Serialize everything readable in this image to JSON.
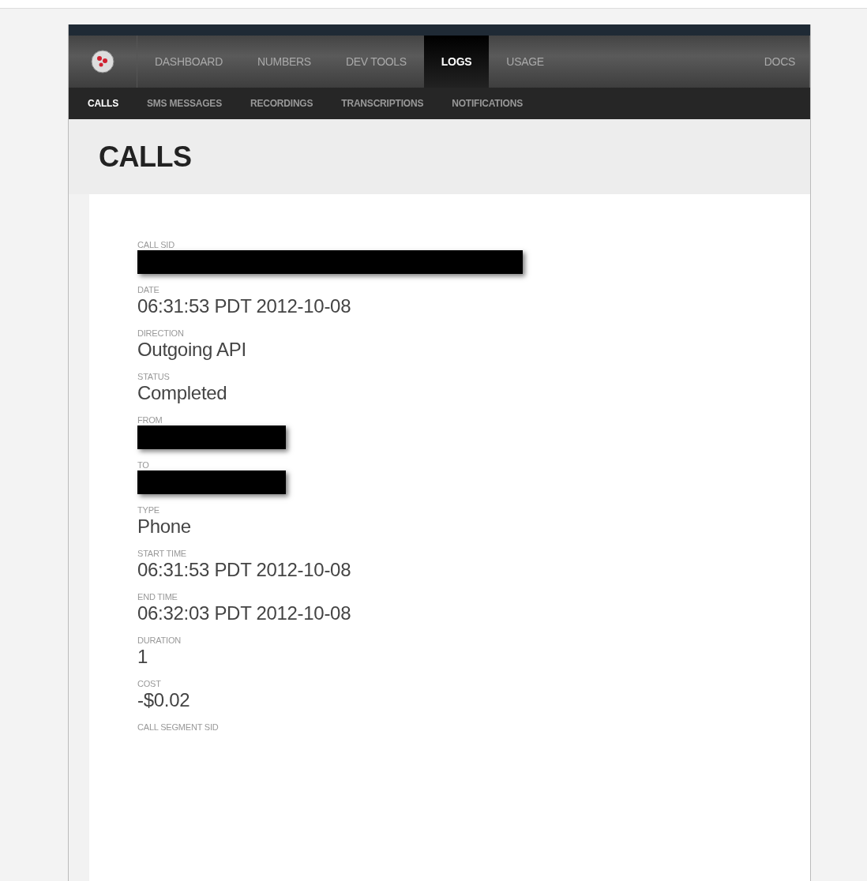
{
  "nav": {
    "items": [
      {
        "label": "DASHBOARD",
        "selected": false
      },
      {
        "label": "NUMBERS",
        "selected": false
      },
      {
        "label": "DEV TOOLS",
        "selected": false
      },
      {
        "label": "LOGS",
        "selected": true
      },
      {
        "label": "USAGE",
        "selected": false
      }
    ],
    "right_items": [
      "DOCS"
    ]
  },
  "subnav": [
    {
      "label": "CALLS",
      "selected": true
    },
    {
      "label": "SMS MESSAGES",
      "selected": false
    },
    {
      "label": "RECORDINGS",
      "selected": false
    },
    {
      "label": "TRANSCRIPTIONS",
      "selected": false
    },
    {
      "label": "NOTIFICATIONS",
      "selected": false
    }
  ],
  "page_title": "CALLS",
  "fields": [
    {
      "kind": "longmask",
      "label": "CALL SID"
    },
    {
      "kind": "text",
      "label": "DATE",
      "value": "06:31:53 PDT 2012-10-08"
    },
    {
      "kind": "text",
      "label": "DIRECTION",
      "value": "Outgoing API"
    },
    {
      "kind": "text",
      "label": "STATUS",
      "value": "Completed"
    },
    {
      "kind": "shortmask",
      "label": "FROM"
    },
    {
      "kind": "shortmask",
      "label": "TO"
    },
    {
      "kind": "text",
      "label": "TYPE",
      "value": "Phone"
    },
    {
      "kind": "text",
      "label": "START TIME",
      "value": "06:31:53 PDT 2012-10-08"
    },
    {
      "kind": "text",
      "label": "END TIME",
      "value": "06:32:03 PDT 2012-10-08"
    },
    {
      "kind": "text",
      "label": "DURATION",
      "value": "1"
    },
    {
      "kind": "text",
      "label": "COST",
      "value": "-$0.02"
    },
    {
      "kind": "label",
      "label": "CALL SEGMENT SID"
    }
  ]
}
